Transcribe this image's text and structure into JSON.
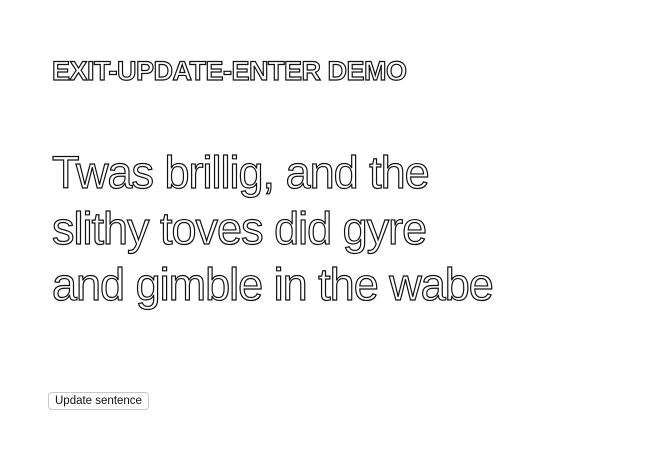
{
  "app": {
    "title": "EXIT-UPDATE-ENTER DEMO"
  },
  "sentence": {
    "lines": [
      "Twas brillig, and the",
      "slithy toves did gyre",
      "and gimble in the wabe"
    ]
  },
  "controls": {
    "update_button_label": "Update sentence"
  },
  "colors": {
    "background": "#ffffff",
    "text_outline": "#111111",
    "button_border": "#c8c8c8"
  }
}
